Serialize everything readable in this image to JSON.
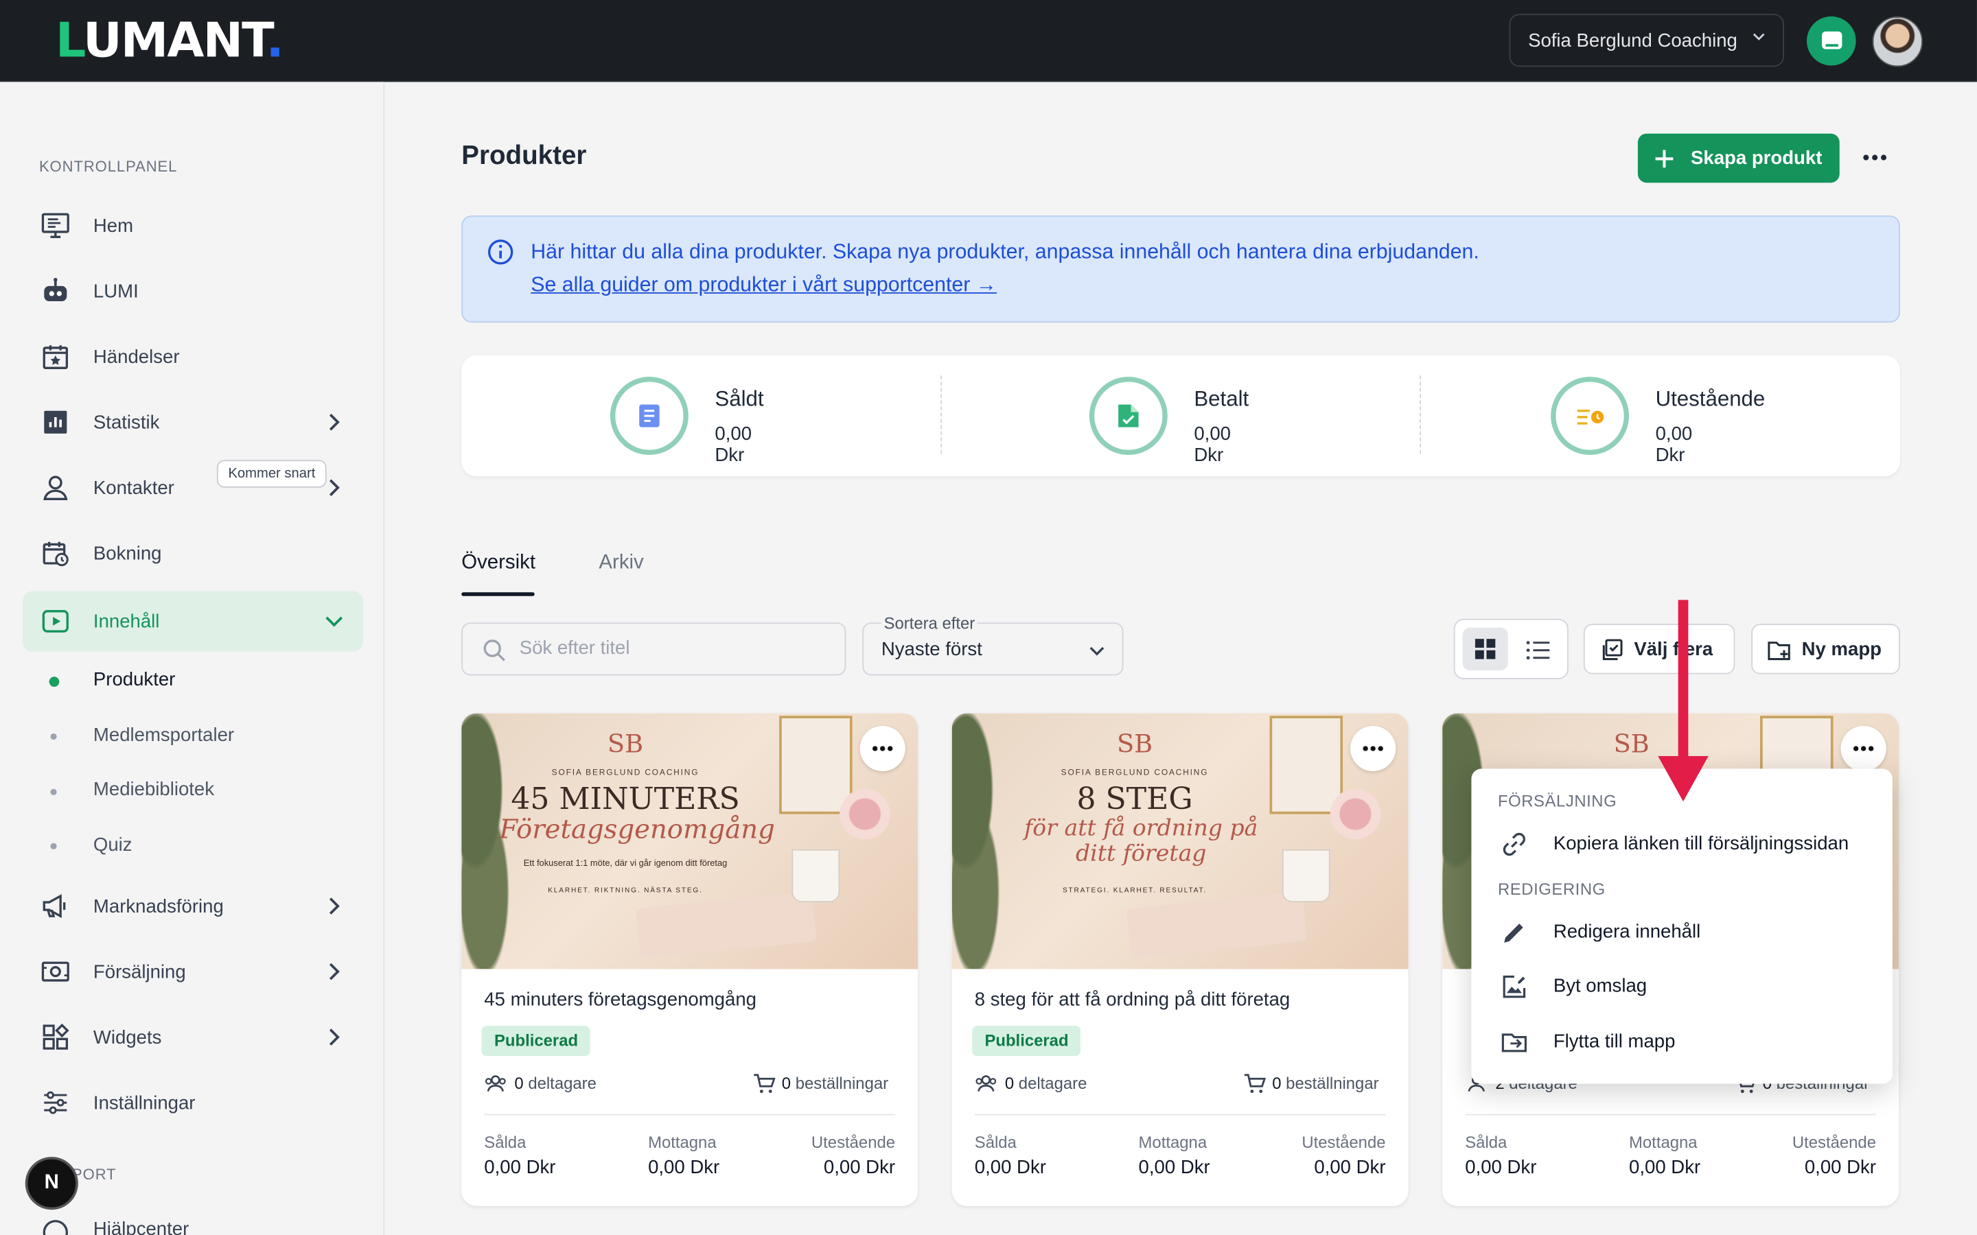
{
  "header": {
    "logo": {
      "first": "L",
      "rest": "UMANT",
      "dot": "."
    },
    "account": "Sofia Berglund Coaching"
  },
  "sidebar": {
    "section1": "KONTROLLPANEL",
    "items": [
      {
        "label": "Hem",
        "icon": "monitor-icon"
      },
      {
        "label": "LUMI",
        "icon": "robot-icon"
      },
      {
        "label": "Händelser",
        "icon": "calendar-star-icon"
      },
      {
        "label": "Statistik",
        "icon": "bar-chart-icon"
      },
      {
        "label": "Kontakter",
        "icon": "person-icon"
      },
      {
        "label": "Bokning",
        "icon": "calendar-clock-icon",
        "badge": "Kommer snart"
      },
      {
        "label": "Innehåll",
        "icon": "play-icon"
      },
      {
        "label": "Marknadsföring",
        "icon": "megaphone-icon"
      },
      {
        "label": "Försäljning",
        "icon": "cash-icon"
      },
      {
        "label": "Widgets",
        "icon": "widgets-icon"
      },
      {
        "label": "Inställningar",
        "icon": "sliders-icon"
      }
    ],
    "subitems": [
      "Produkter",
      "Medlemsportaler",
      "Mediebibliotek",
      "Quiz"
    ],
    "section2": "SUPPORT",
    "help": "Hjälpcenter",
    "n_button": "N"
  },
  "main": {
    "title": "Produkter",
    "create_button": "Skapa produkt",
    "info_text": "Här hittar du alla dina produkter. Skapa nya produkter, anpassa innehåll och hantera dina erbjudanden.",
    "info_link": "Se alla guider om produkter i vårt supportcenter →",
    "stats": [
      {
        "label": "Såldt",
        "value": "0,00 Dkr",
        "icon": "receipt-icon"
      },
      {
        "label": "Betalt",
        "value": "0,00 Dkr",
        "icon": "paid-doc-icon"
      },
      {
        "label": "Utestående",
        "value": "0,00 Dkr",
        "icon": "pending-coin-icon"
      }
    ],
    "tabs": [
      "Översikt",
      "Arkiv"
    ],
    "search_placeholder": "Sök efter titel",
    "sort_label": "Sortera efter",
    "sort_value": "Nyaste först",
    "select_button": "Välj flera",
    "new_folder_button": "Ny mapp"
  },
  "cards": [
    {
      "title": "45 minuters företagsgenomgång",
      "status": "Publicerad",
      "participants": "0",
      "participants_label": "deltagare",
      "orders": "0",
      "orders_label": "beställningar",
      "cols": [
        {
          "label": "Sålda",
          "value": "0,00 Dkr"
        },
        {
          "label": "Mottagna",
          "value": "0,00 Dkr"
        },
        {
          "label": "Utestående",
          "value": "0,00 Dkr"
        }
      ],
      "thumb": {
        "monogram": "SB",
        "coach": "SOFIA BERGLUND COACHING",
        "headline": "45 MINUTERS",
        "script": "Företagsgenomgång",
        "subtitle": "Ett fokuserat 1:1 möte, där vi går igenom ditt företag",
        "tagline": "KLARHET. RIKTNING. NÄSTA STEG."
      }
    },
    {
      "title": "8 steg för att få ordning på ditt företag",
      "status": "Publicerad",
      "participants": "0",
      "participants_label": "deltagare",
      "orders": "0",
      "orders_label": "beställningar",
      "cols": [
        {
          "label": "Sålda",
          "value": "0,00 Dkr"
        },
        {
          "label": "Mottagna",
          "value": "0,00 Dkr"
        },
        {
          "label": "Utestående",
          "value": "0,00 Dkr"
        }
      ],
      "thumb": {
        "monogram": "SB",
        "coach": "SOFIA BERGLUND COACHING",
        "headline": "8 STEG",
        "script": "för att få ordning på ditt företag",
        "subtitle": "",
        "tagline": "STRATEGI. KLARHET. RESULTAT."
      }
    },
    {
      "title": "",
      "status": "",
      "participants": "2",
      "participants_label": "deltagare",
      "orders": "0",
      "orders_label": "beställningar",
      "cols": [
        {
          "label": "Sålda",
          "value": "0,00 Dkr"
        },
        {
          "label": "Mottagna",
          "value": "0,00 Dkr"
        },
        {
          "label": "Utestående",
          "value": "0,00 Dkr"
        }
      ],
      "thumb": {
        "monogram": "SB",
        "coach": "",
        "headline": "",
        "script": "",
        "subtitle": "",
        "tagline": ""
      }
    }
  ],
  "dropdown": {
    "section1": "FÖRSÄLJNING",
    "copy_link": "Kopiera länken till försäljningssidan",
    "section2": "REDIGERING",
    "edit": "Redigera innehåll",
    "cover": "Byt omslag",
    "move": "Flytta till mapp"
  },
  "colors": {
    "accent": "#14935b",
    "topbar": "#1b1e23",
    "info_bg": "#dbe8fb",
    "arrow": "#e11d48"
  }
}
